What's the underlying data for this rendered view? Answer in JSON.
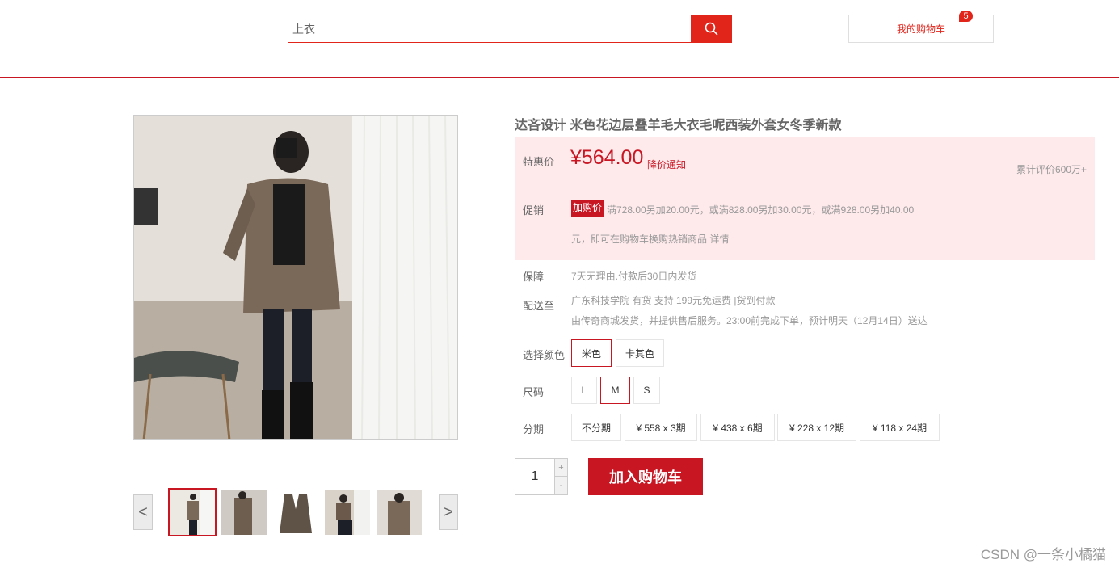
{
  "search": {
    "value": "上衣"
  },
  "cart": {
    "label": "我的购物车",
    "count": "5"
  },
  "product": {
    "title": "达吝设计 米色花边层叠羊毛大衣毛呢西装外套女冬季新款",
    "price_label": "特惠价",
    "price": "¥564.00",
    "price_notice": "降价通知",
    "review_count": "累计评价600万+",
    "promo_label": "促销",
    "promo_tag": "加购价",
    "promo_line1": "满728.00另加20.00元，或满828.00另加30.00元，或满928.00另加40.00",
    "promo_line2": "元，即可在购物车换购热销商品 详情",
    "guarantee_label": "保障",
    "guarantee_text": "7天无理由.付款后30日内发货",
    "delivery_label": "配送至",
    "delivery_line1": "广东科技学院 有货 支持 199元免运费 |货到付款",
    "delivery_line2": "由传奇商城发货，并提供售后服务。23:00前完成下单，预计明天（12月14日）送达"
  },
  "options": {
    "color_label": "选择颜色",
    "colors": [
      "米色",
      "卡其色"
    ],
    "size_label": "尺码",
    "sizes": [
      "L",
      "M",
      "S"
    ],
    "installment_label": "分期",
    "installments": [
      "不分期",
      "¥ 558 x 3期",
      "¥ 438 x 6期",
      "¥ 228 x 12期",
      "¥ 118 x 24期"
    ]
  },
  "purchase": {
    "quantity": "1",
    "plus": "+",
    "minus": "-",
    "add_to_cart": "加入购物车"
  },
  "preview": {
    "prev": "<",
    "next": ">"
  },
  "watermark": "CSDN @一条小橘猫",
  "colors": {
    "accent": "#c81623",
    "search_red": "#e1251b",
    "promo_bg": "#fee9eb"
  }
}
